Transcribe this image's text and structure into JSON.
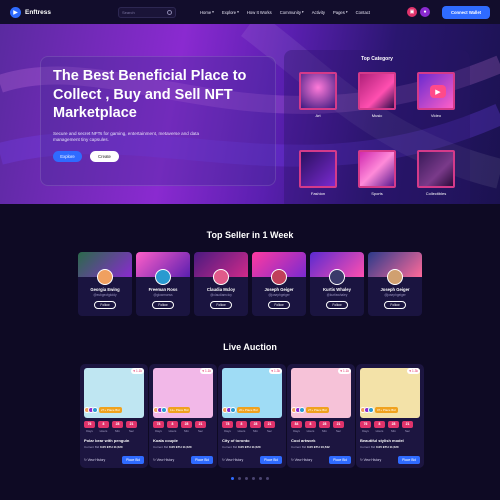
{
  "nav": {
    "logo": "Enftress",
    "search_placeholder": "Search",
    "menu": [
      "Home",
      "Explore",
      "How It Works",
      "Community",
      "Activity",
      "Pages",
      "Contact"
    ],
    "connect": "Connect Wallet",
    "accent": "#2f6bff"
  },
  "hero": {
    "title": "The Best Beneficial Place to Collect , Buy and Sell NFT Marketplace",
    "subtitle": "Secure and secret NFTs for gaming, entertainment, metaverse and data management tiny capsules.",
    "btn_explore": "Explore",
    "btn_create": "Create"
  },
  "top_category": {
    "title": "Top Category",
    "items": [
      "Art",
      "Music",
      "Video",
      "Fashion",
      "Sports",
      "Collectibles"
    ]
  },
  "sellers": {
    "title": "Top Seller in 1 Week",
    "follow": "Follow",
    "items": [
      {
        "name": "Georgia Ewing",
        "handle": "@eubgeofgkddy"
      },
      {
        "name": "Freeman Ross",
        "handle": "@glowmonss"
      },
      {
        "name": "Claudia Mcloy",
        "handle": "@claudiamcloy"
      },
      {
        "name": "Joseph Geiger",
        "handle": "@josephgeiger"
      },
      {
        "name": "Kurtis Whaley",
        "handle": "@kurtiswhaley"
      },
      {
        "name": "Joseph Geiger",
        "handle": "@josephgeiger"
      }
    ]
  },
  "auction": {
    "title": "Live Auction",
    "timer_labels": [
      "Days",
      "Hours",
      "Min",
      "Sec"
    ],
    "current_bid_label": "Current Bid",
    "view_history": "View History",
    "place_bid": "Place Bid",
    "items": [
      {
        "name": "Polar bear with penguin",
        "likes": "1.1k",
        "bids": "27+ Place Bid",
        "timer": [
          "76",
          "8",
          "28",
          "21"
        ],
        "bid": "0.05 ETH 11,520"
      },
      {
        "name": "Koala couple",
        "likes": "1.1k",
        "bids": "11+ Place Bid",
        "timer": [
          "78",
          "8",
          "28",
          "21"
        ],
        "bid": "0.05 ETH 11,520"
      },
      {
        "name": "City of toronto",
        "likes": "1.3k",
        "bids": "20+ Place Bid",
        "timer": [
          "78",
          "8",
          "28",
          "21"
        ],
        "bid": "0.05 ETH 11,520"
      },
      {
        "name": "Cool artwork",
        "likes": "1.1k",
        "bids": "27+ Place Bid",
        "timer": [
          "84",
          "8",
          "28",
          "21"
        ],
        "bid": "0.05 ETH 10,542"
      },
      {
        "name": "Beautiful stylish model",
        "likes": "1.3k",
        "bids": "07+ Place Bid",
        "timer": [
          "76",
          "8",
          "28",
          "21"
        ],
        "bid": "0.05 ETH 11,520"
      }
    ]
  }
}
